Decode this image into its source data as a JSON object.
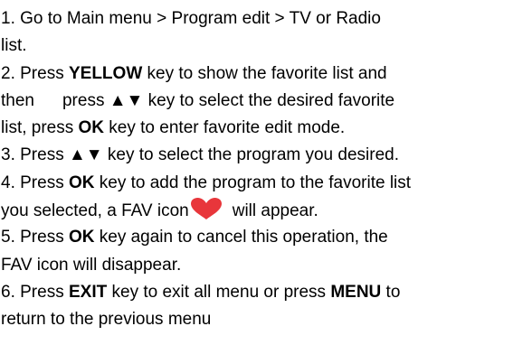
{
  "document": {
    "step1": {
      "line1": "1. Go to Main menu > Program edit > TV or Radio",
      "line2": "list."
    },
    "step2": {
      "a": "2. Press ",
      "key1": "YELLOW",
      "b": " key to show the favorite list and",
      "c": "then",
      "d": "press ",
      "arrows1": "▲▼",
      "e": " key to select the desired favorite",
      "f": "list, press ",
      "key2": "OK",
      "g": " key to enter favorite edit mode."
    },
    "step3": {
      "a": "3. Press ",
      "arrows": "▲▼",
      "b": " key to select the program you desired."
    },
    "step4": {
      "a": "4. Press ",
      "key": "OK",
      "b": " key to add the program to the favorite list",
      "c": "you selected, a FAV icon",
      "d": "will appear."
    },
    "step5": {
      "a": "5. Press ",
      "key": "OK",
      "b": " key again to cancel this operation, the",
      "c": "FAV icon will disappear."
    },
    "step6": {
      "a": "6. Press ",
      "key1": "EXIT",
      "b": " key to exit all menu or press ",
      "key2": "MENU",
      "c": " to",
      "d": "return to the previous menu"
    },
    "fav_icon": {
      "name": "heart-icon",
      "color": "#e8363b"
    }
  }
}
